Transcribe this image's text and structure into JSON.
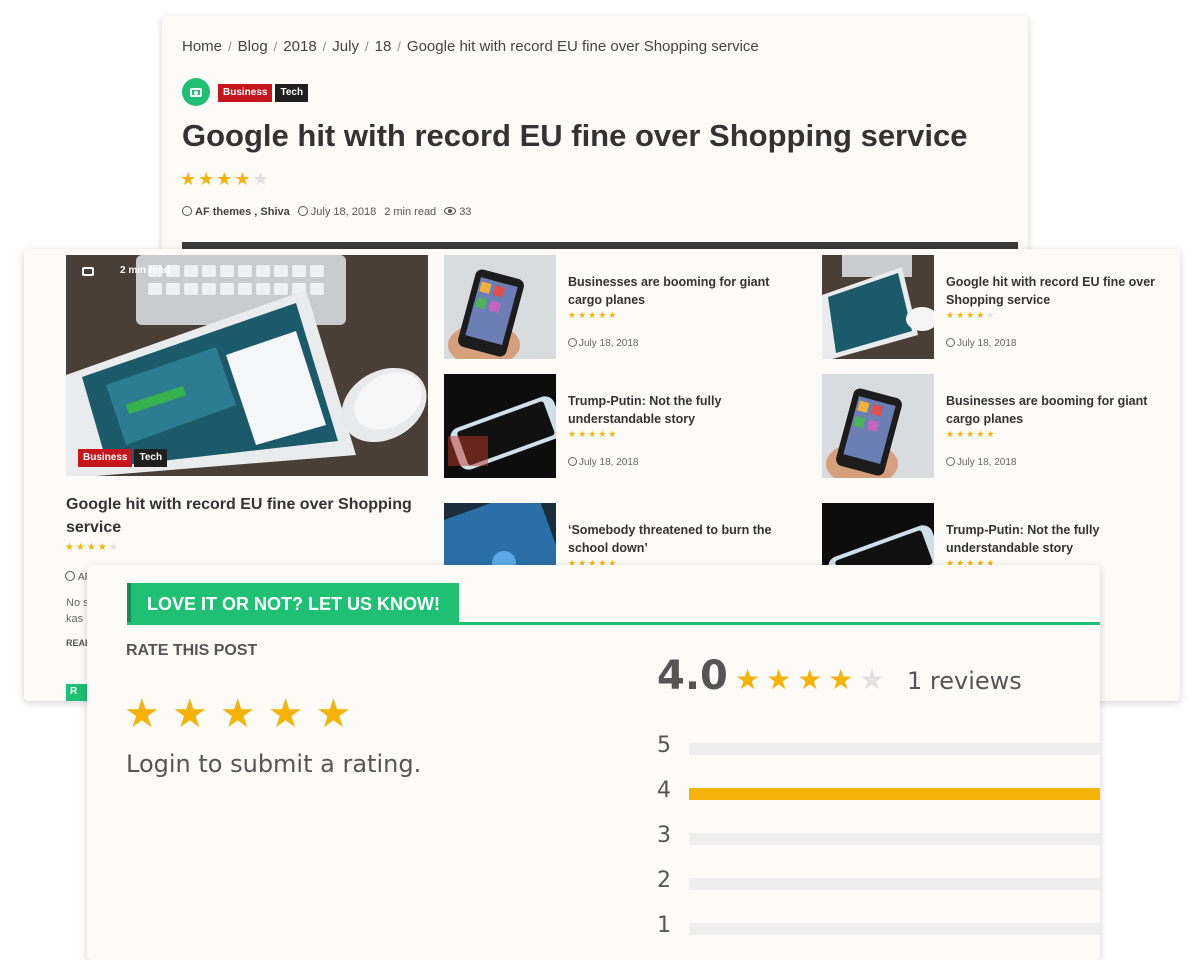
{
  "article": {
    "breadcrumb": [
      "Home",
      "Blog",
      "2018",
      "July",
      "18",
      "Google hit with record EU fine over Shopping service"
    ],
    "tags": [
      "Business",
      "Tech"
    ],
    "title": "Google hit with record EU fine over Shopping service",
    "rating_stars": 4,
    "author": "AF themes , Shiva",
    "date": "July 18, 2018",
    "read_time": "2 min read",
    "views": "33"
  },
  "featured": {
    "read_time": "2 min read",
    "tags": [
      "Business",
      "Tech"
    ],
    "title": "Google hit with record EU fine over Shopping service",
    "rating_stars": 4,
    "author_partial": "AF",
    "excerpt_partial_1": "No s",
    "excerpt_partial_2": "kas",
    "read_more_partial": "READ",
    "button_partial": "R"
  },
  "cards": [
    {
      "title": "Businesses are booming for giant cargo planes",
      "stars": 5,
      "date": "July 18, 2018",
      "thumb": "phone-hand"
    },
    {
      "title": "Google hit with record EU fine over Shopping service",
      "stars": 4,
      "date": "July 18, 2018",
      "thumb": "tablet"
    },
    {
      "title": "Trump-Putin: Not the fully understandable story",
      "stars": 5,
      "date": "July 18, 2018",
      "thumb": "phone-dark"
    },
    {
      "title": "Businesses are booming for giant cargo planes",
      "stars": 5,
      "date": "July 18, 2018",
      "thumb": "phone-hand"
    },
    {
      "title": "‘Somebody threatened to burn the school down’",
      "stars": 5,
      "date": "",
      "thumb": "twitter"
    },
    {
      "title": "Trump-Putin: Not the fully understandable story",
      "stars": 5,
      "date": "",
      "thumb": "phone-dark"
    }
  ],
  "rating": {
    "header": "LOVE IT OR NOT? LET US KNOW!",
    "rate_label": "RATE THIS POST",
    "login_text": "Login to submit a rating.",
    "average": "4.0",
    "average_stars": 4,
    "reviews_text": "1 reviews",
    "distribution": [
      {
        "stars": "5",
        "share": 0
      },
      {
        "stars": "4",
        "share": 1
      },
      {
        "stars": "3",
        "share": 0
      },
      {
        "stars": "2",
        "share": 0
      },
      {
        "stars": "1",
        "share": 0
      }
    ]
  },
  "colors": {
    "accent_green": "#1fbf74",
    "star_gold": "#f5b30a",
    "tag_red": "#c4161c",
    "tag_dark": "#1f1f1f"
  }
}
